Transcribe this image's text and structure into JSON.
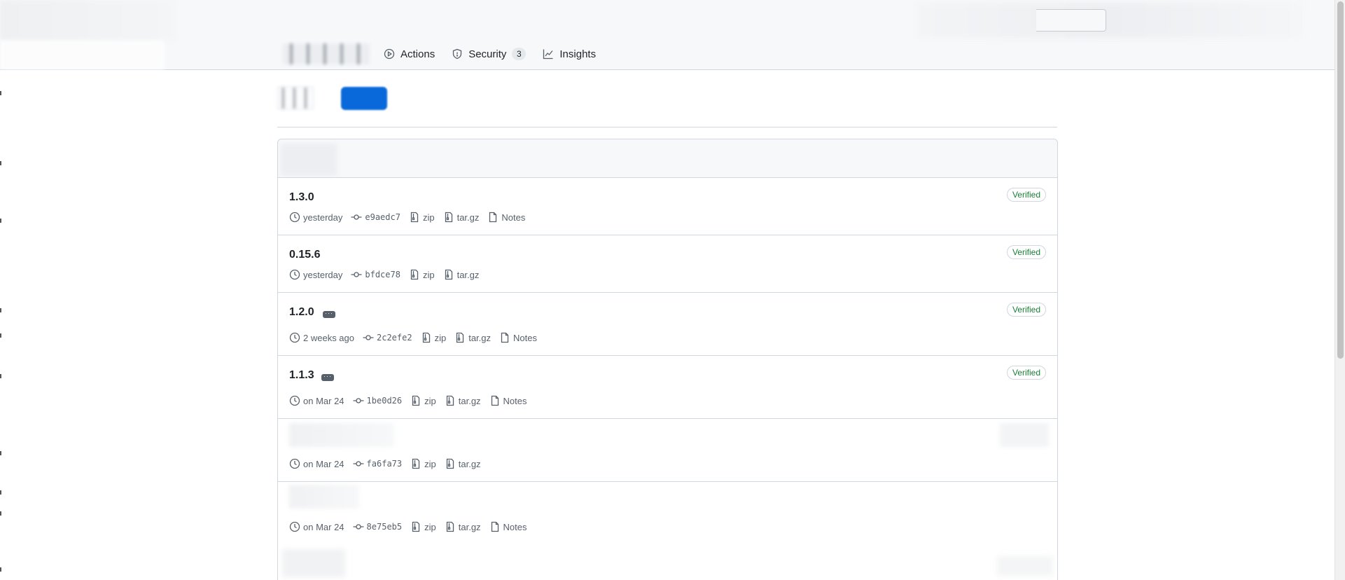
{
  "nav": {
    "tabs": [
      {
        "label": "Actions",
        "icon": "play-icon"
      },
      {
        "label": "Security",
        "icon": "shield-icon",
        "count": "3"
      },
      {
        "label": "Insights",
        "icon": "graph-icon"
      }
    ]
  },
  "releases": [
    {
      "name": "1.3.0",
      "badge": "Verified",
      "time": "yesterday",
      "sha": "e9aedc7",
      "zip": "zip",
      "targz": "tar.gz",
      "notes": "Notes"
    },
    {
      "name": "0.15.6",
      "badge": "Verified",
      "time": "yesterday",
      "sha": "bfdce78",
      "zip": "zip",
      "targz": "tar.gz"
    },
    {
      "name": "1.2.0",
      "badge": "Verified",
      "time": "2 weeks ago",
      "sha": "2c2efe2",
      "zip": "zip",
      "targz": "tar.gz",
      "notes": "Notes"
    },
    {
      "name": "1.1.3",
      "badge": "Verified",
      "time": "on Mar 24",
      "sha": "1be0d26",
      "zip": "zip",
      "targz": "tar.gz",
      "notes": "Notes"
    },
    {
      "time": "on Mar 24",
      "sha": "fa6fa73",
      "zip": "zip",
      "targz": "tar.gz"
    },
    {
      "time": "on Mar 24",
      "sha": "8e75eb5",
      "zip": "zip",
      "targz": "tar.gz",
      "notes": "Notes"
    }
  ],
  "colors": {
    "accent": "#0969da",
    "verified": "#1a7f37",
    "muted": "#57606a",
    "border": "#d0d7de"
  }
}
